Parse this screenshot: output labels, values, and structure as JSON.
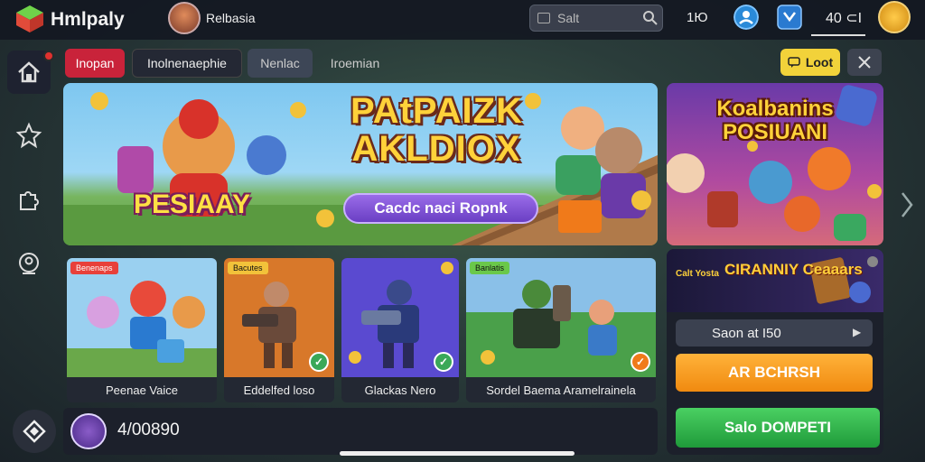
{
  "header": {
    "app_name": "Hmlpaly",
    "username": "Relbasia",
    "search_placeholder": "Salt",
    "count": "1Ю",
    "coins": "40 ⊂I"
  },
  "tabs": [
    {
      "label": "Inopan"
    },
    {
      "label": "Inolnenaephie"
    },
    {
      "label": "Nenlac"
    },
    {
      "label": "Iroemian"
    }
  ],
  "top_right_button": "Loot",
  "hero": {
    "title": "PAtPAIZK AKLDIOX",
    "sticker": "PESIAAY",
    "cta": "Cacdc naci Ropnk"
  },
  "side_banner": {
    "title": "Koalbanins POSIUANI"
  },
  "cards": [
    {
      "tag": "Benenaps",
      "caption": "Peenae Vaice"
    },
    {
      "tag": "Bacutes",
      "caption": "Eddelfed loso"
    },
    {
      "tag": "",
      "caption": "Glackas Nero"
    },
    {
      "tag": "Banlatis",
      "caption": "Sordel Baema Aramelrainela"
    }
  ],
  "promo": {
    "small_text": "Calt Yosta",
    "logo_text": "CIRANNIY Ceaaars",
    "season_label": "Saon at I50",
    "orange_button": "AR BCHRSH",
    "green_button": "Salo DOMPETI"
  },
  "player": {
    "score": "4/00890"
  },
  "colors": {
    "tab_active": "#c9233a",
    "tab_dark": "#242834",
    "accent_yellow": "#f2d23a",
    "accent_orange": "#f59a1c",
    "accent_green": "#2fb14a"
  }
}
